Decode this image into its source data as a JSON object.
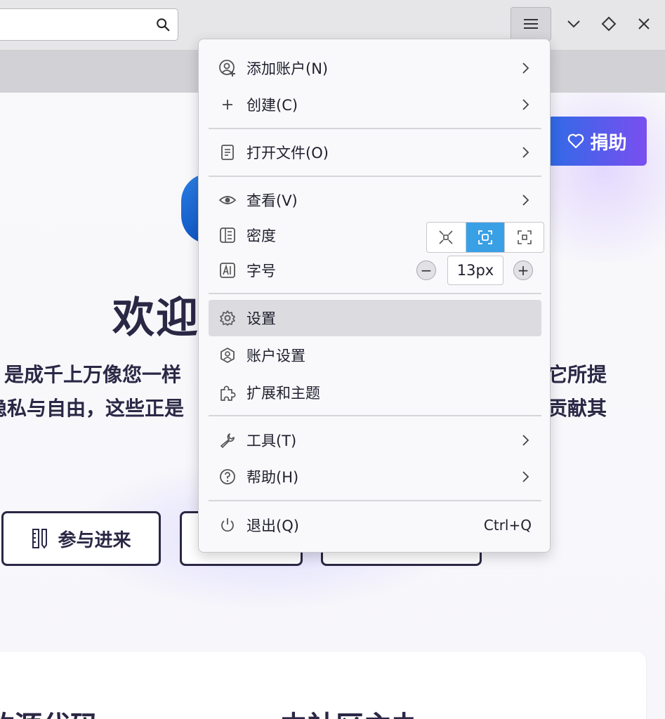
{
  "toolbar": {
    "search_value": "",
    "icons": [
      "search-icon",
      "hamburger-menu-icon",
      "chevron-down-icon",
      "diamond-icon",
      "close-icon"
    ]
  },
  "background_page": {
    "donate_label": "捐助",
    "welcome_fragment": "欢迎",
    "desc_line1_left": "是成千上万像您一样",
    "desc_line1_right": "它所提",
    "desc_line2_left": "隐私与自由，这些正是",
    "desc_line2_right": "贡献其",
    "cta_participate": "参与进来",
    "card_heading_left": "放源代码",
    "card_heading_right": "由社区主办"
  },
  "menu": {
    "add_account": "添加账户(N)",
    "create": "创建(C)",
    "open_file": "打开文件(O)",
    "view": "查看(V)",
    "density": "密度",
    "font_size": "字号",
    "font_size_value": "13px",
    "font_minus": "−",
    "font_plus": "+",
    "settings": "设置",
    "account_settings": "账户设置",
    "addons_themes": "扩展和主题",
    "tools": "工具(T)",
    "help": "帮助(H)",
    "quit": "退出(Q)",
    "quit_shortcut": "Ctrl+Q",
    "density_selected": "default",
    "accent_color": "#3aa0e6",
    "hovered_item": "settings"
  }
}
